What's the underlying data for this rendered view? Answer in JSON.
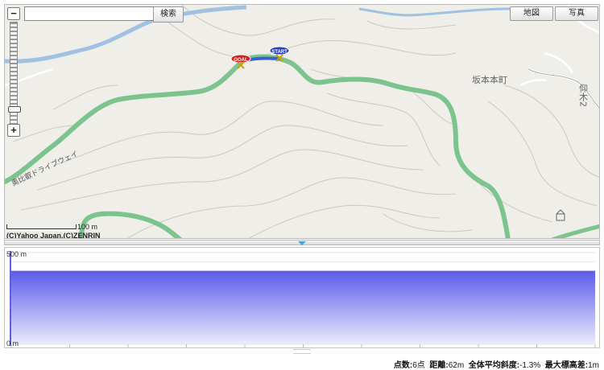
{
  "map": {
    "search_placeholder": "",
    "search_button": "検索",
    "type_buttons": [
      "地図",
      "写真"
    ],
    "zoom_in": "+",
    "zoom_out": "−",
    "labels": {
      "town": "坂本本町",
      "town_right": "仰木2",
      "driveway": "奥比叡ドライブウェイ"
    },
    "markers": {
      "start": "START",
      "goal": "GOAL"
    },
    "scale_label": "100 m",
    "copyright": "(C)Yahoo Japan,(C)ZENRIN",
    "colors": {
      "road": "#7cc48e",
      "route": "#3a5fd0",
      "start": "#2a3fbf",
      "goal": "#d42020"
    }
  },
  "profile": {
    "y_top_label": "500 m",
    "y_bottom_label": "0 m",
    "y_max": 500,
    "elevations": [
      400,
      400,
      400,
      400,
      400,
      400
    ],
    "colors": {
      "fill_top": "#5b5bea",
      "fill_bottom": "#ebebfb",
      "axis": "#2b2bd6"
    }
  },
  "stats": {
    "points_label": "点数:",
    "points_value": "6点",
    "distance_label": "距離:",
    "distance_value": "62m",
    "slope_label": "全体平均斜度:",
    "slope_value": "-1.3%",
    "max_diff_label": "最大標高差:",
    "max_diff_value": "1m"
  }
}
